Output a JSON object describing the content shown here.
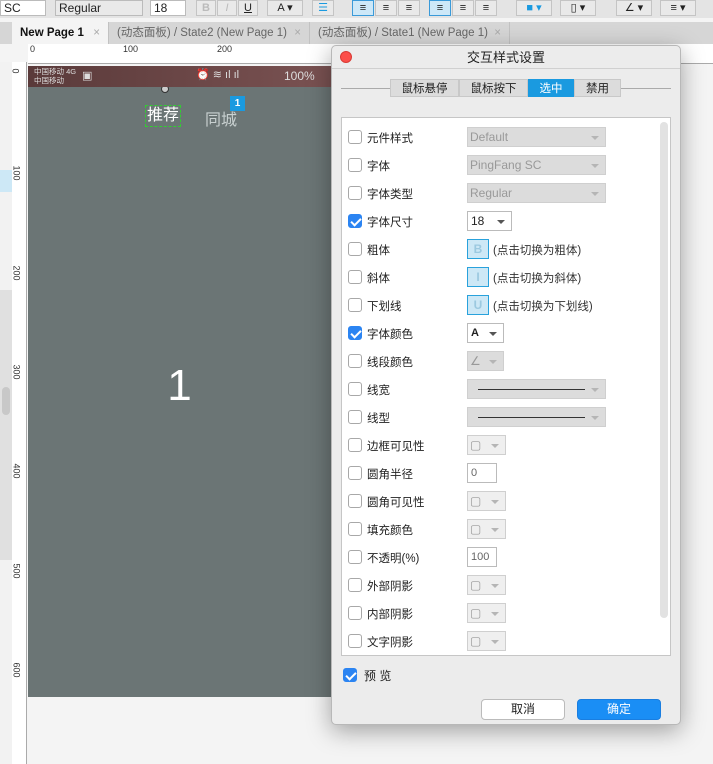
{
  "toolbar": {
    "font": "SC",
    "weight": "Regular",
    "size": "18"
  },
  "tabs": [
    {
      "label": "New Page 1"
    },
    {
      "label": "(动态面板) / State2 (New Page 1)"
    },
    {
      "label": "(动态面板) / State1 (New Page 1)"
    }
  ],
  "ruler": {
    "top": [
      "0",
      "100",
      "200"
    ],
    "left": [
      "0",
      "100",
      "200",
      "300",
      "400",
      "500",
      "600"
    ]
  },
  "phone": {
    "carrier1": "中国移动 4G",
    "carrier2": "中国移动",
    "battery": "100%",
    "tab1": "推荐",
    "tab2": "同城",
    "badge": "1",
    "big_number": "1"
  },
  "dialog": {
    "title": "交互样式设置",
    "tabs": [
      {
        "label": "鼠标悬停"
      },
      {
        "label": "鼠标按下"
      },
      {
        "label": "选中",
        "selected": true
      },
      {
        "label": "禁用"
      }
    ],
    "rows": [
      {
        "label": "元件样式",
        "checked": false,
        "value": "Default"
      },
      {
        "label": "字体",
        "checked": false,
        "value": "PingFang SC"
      },
      {
        "label": "字体类型",
        "checked": false,
        "value": "Regular"
      },
      {
        "label": "字体尺寸",
        "checked": true,
        "value": "18"
      },
      {
        "label": "粗体",
        "checked": false,
        "icon": "B",
        "hint": "(点击切换为粗体)"
      },
      {
        "label": "斜体",
        "checked": false,
        "icon": "I",
        "hint": "(点击切换为斜体)"
      },
      {
        "label": "下划线",
        "checked": false,
        "icon": "U",
        "hint": "(点击切换为下划线)"
      },
      {
        "label": "字体颜色",
        "checked": true,
        "icon": "A"
      },
      {
        "label": "线段颜色",
        "checked": false
      },
      {
        "label": "线宽",
        "checked": false
      },
      {
        "label": "线型",
        "checked": false
      },
      {
        "label": "边框可见性",
        "checked": false
      },
      {
        "label": "圆角半径",
        "checked": false,
        "value": "0"
      },
      {
        "label": "圆角可见性",
        "checked": false
      },
      {
        "label": "填充颜色",
        "checked": false
      },
      {
        "label": "不透明(%)",
        "checked": false,
        "value": "100"
      },
      {
        "label": "外部阴影",
        "checked": false
      },
      {
        "label": "内部阴影",
        "checked": false
      },
      {
        "label": "文字阴影",
        "checked": false
      }
    ],
    "preview": {
      "label": "预 览",
      "checked": true
    },
    "cancel": "取消",
    "ok": "确定"
  },
  "colors": {
    "accent": "#1a9ae0",
    "canvas": "#6b7575"
  }
}
